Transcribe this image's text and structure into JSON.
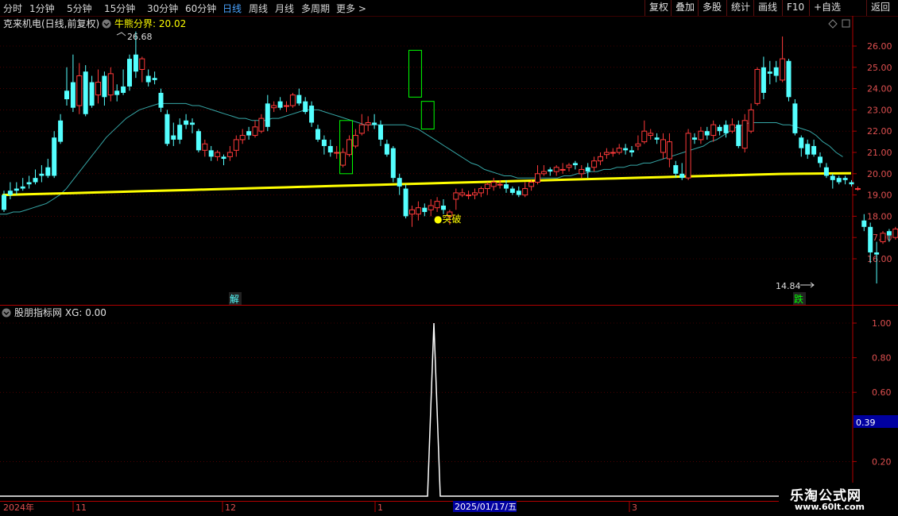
{
  "toolbar": {
    "periods": [
      {
        "label": "分时"
      },
      {
        "label": "1分钟"
      },
      {
        "label": "5分钟"
      },
      {
        "label": "15分钟"
      },
      {
        "label": "30分钟"
      },
      {
        "label": "60分钟"
      },
      {
        "label": "日线",
        "active": true
      },
      {
        "label": "周线"
      },
      {
        "label": "月线"
      },
      {
        "label": "多周期"
      },
      {
        "label": "更多"
      }
    ],
    "more_arrow": ">",
    "tools": [
      "复权",
      "叠加",
      "多股",
      "统计",
      "画线",
      "F10",
      "+自选",
      "返回"
    ]
  },
  "main_header": {
    "stock": "克来机电(日线,前复权)",
    "indicator_name": "牛熊分界",
    "indicator_value": "20.02"
  },
  "sub_header": {
    "name": "股朋指标网",
    "value_label": "XG: 0.00"
  },
  "colors": {
    "up": "#ff3a3a",
    "down": "#54ffff",
    "bull_bear_line": "#ffff00",
    "ma_line": "#36a6a6",
    "grid": "#7a0000",
    "signal": "#ffffff",
    "highlight": "#00ff00"
  },
  "chart_data": [
    {
      "type": "candlestick",
      "title": "克来机电(日线,前复权)",
      "ylim": [
        14.0,
        27.0
      ],
      "y_ticks": [
        "26.00",
        "25.00",
        "24.00",
        "23.00",
        "22.00",
        "21.00",
        "20.00",
        "19.00",
        "18.00",
        "17.00",
        "16.00"
      ],
      "x_labels": [
        "2024年",
        "11",
        "12",
        "1",
        "3"
      ],
      "cursor_date": "2025/01/17/五",
      "annotations": {
        "high": "26.68",
        "low": "14.84",
        "breakout": "●突破",
        "jie": "解",
        "die": "跌"
      },
      "candles": [
        [
          19.0,
          18.3,
          19.2,
          18.2
        ],
        [
          19.2,
          19.0,
          19.6,
          18.8
        ],
        [
          19.3,
          19.2,
          19.6,
          19.0
        ],
        [
          19.4,
          19.3,
          19.8,
          19.2
        ],
        [
          19.6,
          19.5,
          19.9,
          19.3
        ],
        [
          19.8,
          19.6,
          20.2,
          19.5
        ],
        [
          20.0,
          19.9,
          20.4,
          19.6
        ],
        [
          20.3,
          19.9,
          20.7,
          19.8
        ],
        [
          21.7,
          19.9,
          22.0,
          19.8
        ],
        [
          22.5,
          21.5,
          22.8,
          21.4
        ],
        [
          23.9,
          23.5,
          25.0,
          23.2
        ],
        [
          24.3,
          23.1,
          25.6,
          22.9
        ],
        [
          23.2,
          24.6,
          25.2,
          22.8
        ],
        [
          24.8,
          22.8,
          25.1,
          22.7
        ],
        [
          24.3,
          23.2,
          24.6,
          23.1
        ],
        [
          23.7,
          24.3,
          24.9,
          23.3
        ],
        [
          24.6,
          23.6,
          24.8,
          23.2
        ],
        [
          23.7,
          24.7,
          25.0,
          23.4
        ],
        [
          23.9,
          23.7,
          24.2,
          23.4
        ],
        [
          24.1,
          23.8,
          24.9,
          23.7
        ],
        [
          25.4,
          24.1,
          25.6,
          23.9
        ],
        [
          25.6,
          24.8,
          26.68,
          24.5
        ],
        [
          24.9,
          25.4,
          25.5,
          24.3
        ],
        [
          24.6,
          24.3,
          24.9,
          24.1
        ],
        [
          24.5,
          24.4,
          24.8,
          24.2
        ],
        [
          23.8,
          23.1,
          24.0,
          22.9
        ],
        [
          22.8,
          21.4,
          23.0,
          21.3
        ],
        [
          21.8,
          21.6,
          22.4,
          21.3
        ],
        [
          22.3,
          21.6,
          22.6,
          21.4
        ],
        [
          22.5,
          22.3,
          22.8,
          22.1
        ],
        [
          22.4,
          22.3,
          22.6,
          21.9
        ],
        [
          22.0,
          21.1,
          22.1,
          21.0
        ],
        [
          21.1,
          21.4,
          21.6,
          20.8
        ],
        [
          21.1,
          20.8,
          21.3,
          20.6
        ],
        [
          20.8,
          21.0,
          21.1,
          20.6
        ],
        [
          20.8,
          20.7,
          20.9,
          20.4
        ],
        [
          20.8,
          21.0,
          21.3,
          20.6
        ],
        [
          21.1,
          21.6,
          21.8,
          20.8
        ],
        [
          21.6,
          21.8,
          22.1,
          21.4
        ],
        [
          22.0,
          21.8,
          22.2,
          21.6
        ],
        [
          21.8,
          22.2,
          22.5,
          21.7
        ],
        [
          22.0,
          22.6,
          22.8,
          21.9
        ],
        [
          23.3,
          22.2,
          23.7,
          22.0
        ],
        [
          23.1,
          23.2,
          23.4,
          22.9
        ],
        [
          23.4,
          23.1,
          23.6,
          23.0
        ],
        [
          23.2,
          23.2,
          23.4,
          22.9
        ],
        [
          23.2,
          23.7,
          23.8,
          23.1
        ],
        [
          23.7,
          23.3,
          24.0,
          23.2
        ],
        [
          23.4,
          22.9,
          23.6,
          22.8
        ],
        [
          23.2,
          22.4,
          23.4,
          22.2
        ],
        [
          22.1,
          21.6,
          22.3,
          21.5
        ],
        [
          21.6,
          21.3,
          21.8,
          20.9
        ],
        [
          21.3,
          21.0,
          21.6,
          20.8
        ],
        [
          21.0,
          21.0,
          21.3,
          20.7
        ],
        [
          20.4,
          21.0,
          21.2,
          20.3
        ],
        [
          20.9,
          21.6,
          21.8,
          20.8
        ],
        [
          21.3,
          21.8,
          22.1,
          21.2
        ],
        [
          21.9,
          22.3,
          22.8,
          21.8
        ],
        [
          22.3,
          22.4,
          22.7,
          22.0
        ],
        [
          22.4,
          22.3,
          22.8,
          22.1
        ],
        [
          22.3,
          21.6,
          22.5,
          21.3
        ],
        [
          21.4,
          20.9,
          21.6,
          20.8
        ],
        [
          21.2,
          19.8,
          21.3,
          19.6
        ],
        [
          19.8,
          19.4,
          20.0,
          19.0
        ],
        [
          19.3,
          18.0,
          19.5,
          17.9
        ],
        [
          18.1,
          18.3,
          18.5,
          17.5
        ],
        [
          18.1,
          18.4,
          18.7,
          17.8
        ],
        [
          18.4,
          18.2,
          18.6,
          18.0
        ],
        [
          18.3,
          18.5,
          18.8,
          18.0
        ],
        [
          18.4,
          18.7,
          18.9,
          18.2
        ],
        [
          18.5,
          18.3,
          18.8,
          18.1
        ],
        [
          18.0,
          18.2,
          18.3,
          17.6
        ],
        [
          18.8,
          19.1,
          19.3,
          18.3
        ],
        [
          19.0,
          19.1,
          19.3,
          18.9
        ],
        [
          19.0,
          19.0,
          19.2,
          18.8
        ],
        [
          19.0,
          19.1,
          19.3,
          18.8
        ],
        [
          19.1,
          19.3,
          19.4,
          18.9
        ],
        [
          19.3,
          19.5,
          19.6,
          19.0
        ],
        [
          19.4,
          19.6,
          19.8,
          19.2
        ],
        [
          19.5,
          19.5,
          19.7,
          19.3
        ],
        [
          19.5,
          19.3,
          19.7,
          19.1
        ],
        [
          19.3,
          19.1,
          19.4,
          19.0
        ],
        [
          19.2,
          19.0,
          19.4,
          18.9
        ],
        [
          19.0,
          19.3,
          19.6,
          18.9
        ],
        [
          19.4,
          19.6,
          19.7,
          19.2
        ],
        [
          19.6,
          20.0,
          20.4,
          19.5
        ],
        [
          20.0,
          20.1,
          20.4,
          19.9
        ],
        [
          20.2,
          20.1,
          20.3,
          19.9
        ],
        [
          20.1,
          20.3,
          20.4,
          19.9
        ],
        [
          20.2,
          20.2,
          20.5,
          20.0
        ],
        [
          20.3,
          20.4,
          20.5,
          20.1
        ],
        [
          20.5,
          20.4,
          20.6,
          20.2
        ],
        [
          20.0,
          20.2,
          20.4,
          19.8
        ],
        [
          20.3,
          20.1,
          20.5,
          19.8
        ],
        [
          20.3,
          20.6,
          20.8,
          20.1
        ],
        [
          20.6,
          20.8,
          21.0,
          20.4
        ],
        [
          20.9,
          21.0,
          21.2,
          20.7
        ],
        [
          21.0,
          21.0,
          21.2,
          20.8
        ],
        [
          21.0,
          21.2,
          21.4,
          20.9
        ],
        [
          21.2,
          21.1,
          21.4,
          20.9
        ],
        [
          21.1,
          21.0,
          21.3,
          20.8
        ],
        [
          21.3,
          21.4,
          21.8,
          21.1
        ],
        [
          21.5,
          22.0,
          22.5,
          21.4
        ],
        [
          21.8,
          21.9,
          22.1,
          21.6
        ],
        [
          21.7,
          21.6,
          21.9,
          21.4
        ],
        [
          21.0,
          21.6,
          21.9,
          20.7
        ],
        [
          20.7,
          21.5,
          21.9,
          20.3
        ],
        [
          20.4,
          20.0,
          20.6,
          19.8
        ],
        [
          20.0,
          19.8,
          20.5,
          19.7
        ],
        [
          19.8,
          21.9,
          22.1,
          19.7
        ],
        [
          21.7,
          21.6,
          21.9,
          21.4
        ],
        [
          21.6,
          22.0,
          22.2,
          21.4
        ],
        [
          22.0,
          21.8,
          22.2,
          21.6
        ],
        [
          21.8,
          22.3,
          22.5,
          21.5
        ],
        [
          22.2,
          22.0,
          22.3,
          21.8
        ],
        [
          22.3,
          21.9,
          22.5,
          21.7
        ],
        [
          22.0,
          22.3,
          22.6,
          21.9
        ],
        [
          22.3,
          21.3,
          22.5,
          21.2
        ],
        [
          21.2,
          22.5,
          22.8,
          21.0
        ],
        [
          22.0,
          23.0,
          23.3,
          21.9
        ],
        [
          23.3,
          24.9,
          25.0,
          23.2
        ],
        [
          25.0,
          23.8,
          25.5,
          23.5
        ],
        [
          24.8,
          24.7,
          25.3,
          24.2
        ],
        [
          25.0,
          24.6,
          25.3,
          24.3
        ],
        [
          24.4,
          25.4,
          26.45,
          24.3
        ],
        [
          25.3,
          23.6,
          25.4,
          23.4
        ],
        [
          23.3,
          21.9,
          23.5,
          21.8
        ],
        [
          21.7,
          21.2,
          21.8,
          20.8
        ],
        [
          21.4,
          20.9,
          21.6,
          20.7
        ],
        [
          21.3,
          20.9,
          21.6,
          20.8
        ],
        [
          20.8,
          20.5,
          21.0,
          20.3
        ],
        [
          20.3,
          19.9,
          20.5,
          19.8
        ],
        [
          19.9,
          19.7,
          20.0,
          19.3
        ],
        [
          19.8,
          19.6,
          19.9,
          19.5
        ],
        [
          19.8,
          19.7,
          19.9,
          19.5
        ],
        [
          19.6,
          19.5,
          19.7,
          19.4
        ],
        [
          19.3,
          19.3,
          19.4,
          19.2
        ],
        [
          17.8,
          17.5,
          18.1,
          17.3
        ],
        [
          17.5,
          16.3,
          17.7,
          15.8
        ],
        [
          16.3,
          16.2,
          16.8,
          14.84
        ],
        [
          16.8,
          17.2,
          17.3,
          16.7
        ],
        [
          17.3,
          17.1,
          17.4,
          16.8
        ],
        [
          17.0,
          17.4,
          17.5,
          16.9
        ],
        [
          17.3,
          17.5,
          17.6,
          17.2
        ],
        [
          17.6,
          17.6,
          17.8,
          17.3
        ],
        [
          17.6,
          17.4,
          17.8,
          17.3
        ],
        [
          17.4,
          17.0,
          17.5,
          16.8
        ]
      ],
      "boxes": [
        {
          "start": 54,
          "end": 55,
          "high": 22.5,
          "low": 20.0
        },
        {
          "start": 65,
          "end": 66,
          "high": 25.8,
          "low": 23.6
        },
        {
          "start": 67,
          "end": 68,
          "high": 23.4,
          "low": 22.1
        }
      ],
      "series": [
        {
          "values": [
            18.1,
            18.1,
            18.2,
            18.2,
            18.3,
            18.4,
            18.5,
            18.6,
            18.8,
            19.0,
            19.3,
            19.7,
            20.1,
            20.5,
            20.9,
            21.3,
            21.7,
            22.0,
            22.3,
            22.6,
            22.8,
            23.0,
            23.1,
            23.2,
            23.3,
            23.3,
            23.3,
            23.3,
            23.3,
            23.2,
            23.2,
            23.1,
            23.0,
            22.9,
            22.8,
            22.7,
            22.6,
            22.6,
            22.5,
            22.5,
            22.5,
            22.6,
            22.6,
            22.7,
            22.8,
            22.9,
            23.0,
            23.0,
            23.0,
            22.9,
            22.8,
            22.7,
            22.6,
            22.5,
            22.4,
            22.3,
            22.3,
            22.3,
            22.3,
            22.3,
            22.3,
            22.3,
            22.2,
            22.1,
            21.9,
            21.7,
            21.5,
            21.3,
            21.1,
            20.9,
            20.7,
            20.5,
            20.4,
            20.2,
            20.1,
            20.0,
            19.9,
            19.9,
            19.8,
            19.8,
            19.8,
            19.8,
            19.8,
            19.8,
            19.8,
            19.9,
            19.9,
            20.0,
            20.0,
            20.1,
            20.1,
            20.2,
            20.2,
            20.3,
            20.3,
            20.4,
            20.4,
            20.5,
            20.5,
            20.6,
            20.7,
            20.8,
            20.9,
            21.0,
            21.1,
            21.2,
            21.3,
            21.5,
            21.6,
            21.8,
            22.0,
            22.2,
            22.3,
            22.4,
            22.4,
            22.4,
            22.4,
            22.4,
            22.3,
            22.3,
            22.2,
            22.1,
            22.0,
            21.8,
            21.5,
            21.3,
            21.0,
            20.8
          ]
        },
        {
          "values": [
            19.0,
            19.03,
            19.06,
            19.09,
            19.12,
            19.15,
            19.18,
            19.21,
            19.24,
            19.27,
            19.3,
            19.33,
            19.36,
            19.39,
            19.42,
            19.45,
            19.48,
            19.51,
            19.54,
            19.57,
            19.6,
            19.63,
            19.66,
            19.69,
            19.72,
            19.75,
            19.78,
            19.81,
            19.84,
            19.87,
            19.9,
            19.93,
            19.96,
            19.99,
            20.0,
            20.01,
            20.02
          ]
        }
      ],
      "signal_pulse": {
        "peak_index": 66,
        "peak": 1.0
      }
    },
    {
      "type": "line",
      "title": "股朋指标网",
      "ylim": [
        0.0,
        1.1
      ],
      "y_ticks": [
        "1.00",
        "0.80",
        "0.60",
        "0.39",
        "0.20"
      ],
      "cursor_value": "0.39"
    }
  ]
}
